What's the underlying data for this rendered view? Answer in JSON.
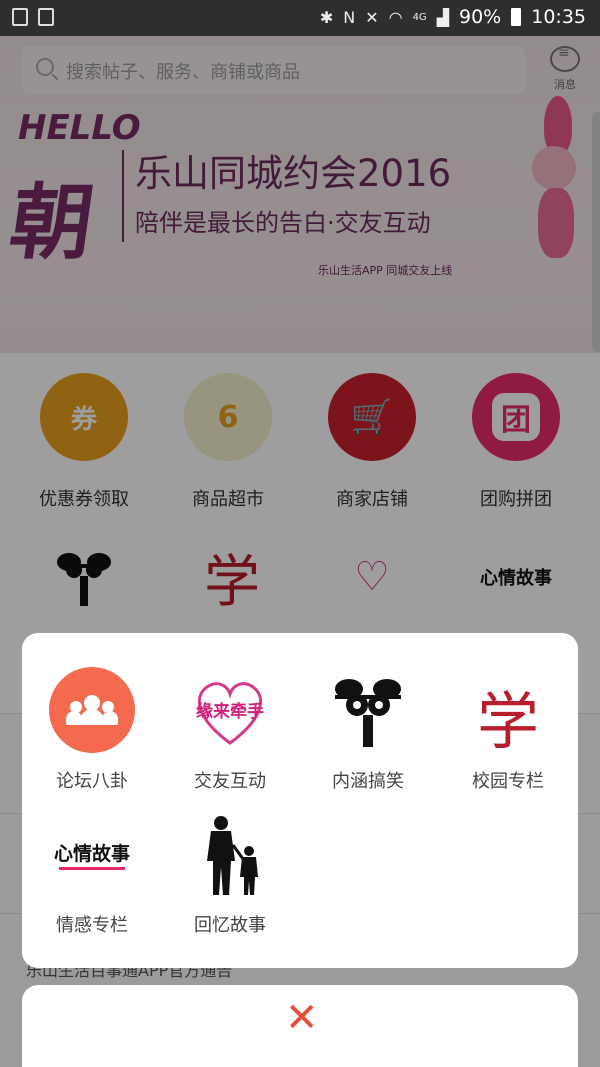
{
  "status_bar": {
    "battery_percent": "90%",
    "time": "10:35",
    "network": "4G"
  },
  "header": {
    "search_placeholder": "搜索帖子、服务、商铺或商品",
    "message_label": "消息"
  },
  "banner": {
    "hello": "HELLO",
    "big_char": "朝",
    "title": "乐山同城约会2016",
    "subtitle": "陪伴是最长的告白·交友互动",
    "tagline": "乐山生活APP  同城交友上线"
  },
  "categories": [
    {
      "label": "优惠券领取",
      "icon": "coupon-icon"
    },
    {
      "label": "商品超市",
      "icon": "supermarket-icon"
    },
    {
      "label": "商家店铺",
      "icon": "cart-icon"
    },
    {
      "label": "团购拼团",
      "icon": "groupbuy-icon"
    }
  ],
  "categories_row2": [
    {
      "icon": "funny-dog-icon"
    },
    {
      "icon": "campus-char-icon"
    },
    {
      "icon": "dating-heart-icon"
    },
    {
      "icon": "heart-story-icon"
    }
  ],
  "sheet": {
    "items": [
      {
        "label": "论坛八卦",
        "icon": "forum-people-icon"
      },
      {
        "label": "交友互动",
        "icon": "dating-heart-icon",
        "art": "缘来牵手"
      },
      {
        "label": "内涵搞笑",
        "icon": "funny-dog-icon"
      },
      {
        "label": "校园专栏",
        "icon": "campus-char-icon",
        "art": "学"
      },
      {
        "label": "情感专栏",
        "icon": "heart-story-icon",
        "art": "心情故事"
      },
      {
        "label": "回忆故事",
        "icon": "memory-silhouette-icon"
      }
    ]
  },
  "close_label": "✕",
  "feed": {
    "behind_text": "乐山生活百事通APP官方通告"
  }
}
